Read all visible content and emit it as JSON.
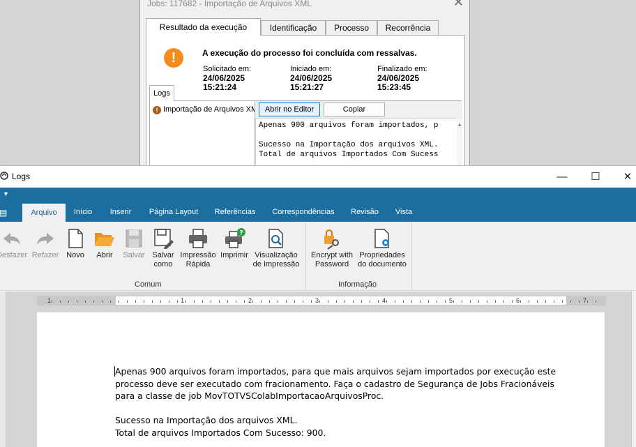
{
  "jobs_dialog": {
    "title": "Jobs: 117682 - Importação de Arquivos XML",
    "close_glyph": "✕",
    "tabs": [
      {
        "label": "Resultado da execução",
        "active": true
      },
      {
        "label": "Identificação",
        "active": false
      },
      {
        "label": "Processo",
        "active": false
      },
      {
        "label": "Recorrência",
        "active": false
      }
    ],
    "warning_glyph": "!",
    "result_message": "A execução do processo foi concluída com ressalvas.",
    "dates": [
      {
        "label": "Solicitado em:",
        "date": "24/06/2025",
        "time": "15:21:24"
      },
      {
        "label": "Iniciado em:",
        "date": "24/06/2025",
        "time": "15:21:27"
      },
      {
        "label": "Finalizado em:",
        "date": "24/06/2025",
        "time": "15:23:45"
      }
    ],
    "logs_tab": "Logs",
    "log_item": "Importação de Arquivos XML",
    "open_editor_button": "Abrir no Editor",
    "copy_button": "Copiar",
    "log_text": "Apenas 900 arquivos foram importados, p\n\nSucesso na Importação dos arquivos XML.\nTotal de arquivos Importados Com Sucess"
  },
  "logs_window": {
    "title": "Logs",
    "controls": {
      "minimize": "—",
      "maximize": "☐",
      "close": "✕"
    },
    "tabs": [
      "Arquivo",
      "Início",
      "Inserir",
      "Página Layout",
      "Referências",
      "Correspondências",
      "Revisão",
      "Vista"
    ],
    "active_tab": "Arquivo",
    "ribbon": {
      "buttons": [
        {
          "label1": "Desfazer",
          "label2": ""
        },
        {
          "label1": "Refazer",
          "label2": ""
        },
        {
          "label1": "Novo",
          "label2": ""
        },
        {
          "label1": "Abrir",
          "label2": ""
        },
        {
          "label1": "Salvar",
          "label2": ""
        },
        {
          "label1": "Salvar",
          "label2": "como"
        },
        {
          "label1": "Impressão",
          "label2": "Rápida"
        },
        {
          "label1": "Imprimir",
          "label2": ""
        },
        {
          "label1": "Visualização",
          "label2": "de Impressão"
        },
        {
          "label1": "Encrypt with",
          "label2": "Password"
        },
        {
          "label1": "Propriedades",
          "label2": "do documento"
        }
      ],
      "group_comum": "Comum",
      "group_informacao": "Informação"
    },
    "ruler_numbers": [
      "1",
      "1",
      "2",
      "3",
      "4",
      "5",
      "6",
      "7"
    ],
    "document": {
      "paragraph1": "Apenas 900 arquivos foram importados, para que mais arquivos sejam importados por execução este processo deve ser executado com fracionamento. Faça o cadastro de Segurança de Jobs Fracionáveis para a classe de job MovTOTVSColabImportacaoArquivosProc.",
      "line2": "Sucesso na Importação dos arquivos XML.",
      "line3": "Total de arquivos Importados Com Sucesso: 900."
    }
  },
  "colors": {
    "ribbon_blue": "#1b6fa0",
    "ribbon_bg": "#eef0f2",
    "warning_orange": "#f28c1e"
  }
}
